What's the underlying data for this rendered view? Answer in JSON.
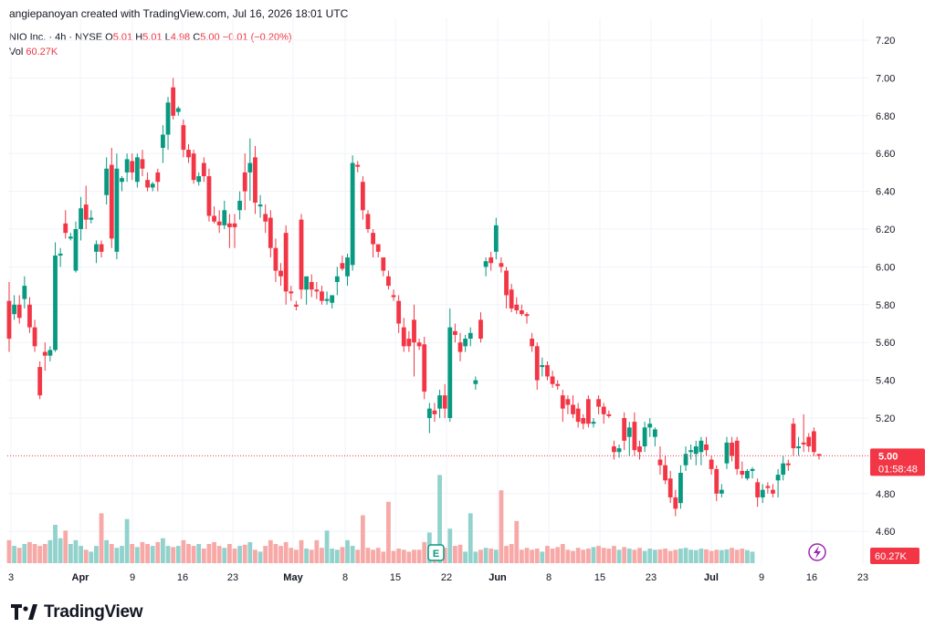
{
  "header": {
    "credit": "angiepanoyan created with TradingView.com, Jul 16, 2026 18:01 UTC"
  },
  "legend": {
    "symbol": "NIO Inc. · 4h · NYSE",
    "o_label": "O",
    "o_value": "5.01",
    "h_label": "H",
    "h_value": "5.01",
    "l_label": "L",
    "l_value": "4.98",
    "c_label": "C",
    "c_value": "5.00",
    "change": "−0.01 (−0.20%)",
    "vol_label": "Vol",
    "vol_value": "60.27K"
  },
  "brand": {
    "name": "TradingView"
  },
  "colors": {
    "up": "#089981",
    "down": "#f23645",
    "up_vol": "#92d2cc",
    "down_vol": "#f7a9a7",
    "grid": "#f0f3fa",
    "axis_text": "#131722"
  },
  "chart_data": {
    "type": "candlestick",
    "symbol": "NIO",
    "interval": "4h",
    "exchange": "NYSE",
    "ylim": [
      4.48,
      7.3
    ],
    "y_ticks": [
      "7.20",
      "7.00",
      "6.80",
      "6.60",
      "6.40",
      "6.20",
      "6.00",
      "5.80",
      "5.60",
      "5.40",
      "5.20",
      "4.80",
      "4.60"
    ],
    "x_ticks": [
      "3",
      "Apr",
      "9",
      "16",
      "23",
      "May",
      "8",
      "15",
      "22",
      "Jun",
      "8",
      "15",
      "23",
      "Jul",
      "9",
      "16",
      "23"
    ],
    "last_price": "5.00",
    "countdown": "01:58:48",
    "last_volume": "60.27K",
    "earnings_marker": "E",
    "candles": [
      [
        5.82,
        5.92,
        5.55,
        5.62
      ],
      [
        5.75,
        5.85,
        5.72,
        5.8
      ],
      [
        5.8,
        5.85,
        5.7,
        5.73
      ],
      [
        5.83,
        5.95,
        5.78,
        5.9
      ],
      [
        5.8,
        5.84,
        5.65,
        5.68
      ],
      [
        5.68,
        5.72,
        5.55,
        5.58
      ],
      [
        5.47,
        5.5,
        5.3,
        5.32
      ],
      [
        5.55,
        5.6,
        5.45,
        5.53
      ],
      [
        5.53,
        5.58,
        5.5,
        5.56
      ],
      [
        5.56,
        6.13,
        5.55,
        6.06
      ],
      [
        6.06,
        6.1,
        6.0,
        6.07
      ],
      [
        6.23,
        6.3,
        6.15,
        6.18
      ],
      [
        6.15,
        6.18,
        6.14,
        6.16
      ],
      [
        5.98,
        6.24,
        5.97,
        6.2
      ],
      [
        6.2,
        6.37,
        6.14,
        6.31
      ],
      [
        6.33,
        6.43,
        6.2,
        6.25
      ],
      [
        6.25,
        6.3,
        6.23,
        6.26
      ],
      [
        6.08,
        6.14,
        6.02,
        6.12
      ],
      [
        6.12,
        6.14,
        6.05,
        6.08
      ],
      [
        6.38,
        6.58,
        6.33,
        6.52
      ],
      [
        6.54,
        6.63,
        6.1,
        6.15
      ],
      [
        6.08,
        6.6,
        6.04,
        6.52
      ],
      [
        6.45,
        6.48,
        6.4,
        6.47
      ],
      [
        6.5,
        6.6,
        6.45,
        6.57
      ],
      [
        6.56,
        6.6,
        6.46,
        6.5
      ],
      [
        6.45,
        6.6,
        6.42,
        6.58
      ],
      [
        6.57,
        6.62,
        6.48,
        6.52
      ],
      [
        6.46,
        6.5,
        6.4,
        6.42
      ],
      [
        6.42,
        6.45,
        6.4,
        6.44
      ],
      [
        6.5,
        6.52,
        6.4,
        6.45
      ],
      [
        6.63,
        6.75,
        6.55,
        6.7
      ],
      [
        6.7,
        6.9,
        6.62,
        6.87
      ],
      [
        6.95,
        7.0,
        6.78,
        6.8
      ],
      [
        6.82,
        6.85,
        6.8,
        6.84
      ],
      [
        6.75,
        6.78,
        6.58,
        6.62
      ],
      [
        6.62,
        6.65,
        6.55,
        6.58
      ],
      [
        6.6,
        6.62,
        6.44,
        6.46
      ],
      [
        6.45,
        6.5,
        6.43,
        6.48
      ],
      [
        6.55,
        6.58,
        6.45,
        6.48
      ],
      [
        6.48,
        6.52,
        6.24,
        6.27
      ],
      [
        6.27,
        6.32,
        6.23,
        6.24
      ],
      [
        6.24,
        6.3,
        6.18,
        6.22
      ],
      [
        6.22,
        6.35,
        6.2,
        6.3
      ],
      [
        6.23,
        6.28,
        6.1,
        6.21
      ],
      [
        6.23,
        6.28,
        6.1,
        6.21
      ],
      [
        6.3,
        6.4,
        6.25,
        6.35
      ],
      [
        6.5,
        6.6,
        6.3,
        6.4
      ],
      [
        6.5,
        6.68,
        6.35,
        6.55
      ],
      [
        6.58,
        6.64,
        6.28,
        6.34
      ],
      [
        6.32,
        6.38,
        6.26,
        6.33
      ],
      [
        6.28,
        6.33,
        6.18,
        6.24
      ],
      [
        6.26,
        6.3,
        6.05,
        6.1
      ],
      [
        6.1,
        6.15,
        5.92,
        5.98
      ],
      [
        5.98,
        6.02,
        5.9,
        5.95
      ],
      [
        6.18,
        6.22,
        5.8,
        5.87
      ],
      [
        5.87,
        5.9,
        5.82,
        5.86
      ],
      [
        5.8,
        5.82,
        5.77,
        5.79
      ],
      [
        6.25,
        6.28,
        5.83,
        5.88
      ],
      [
        5.88,
        5.94,
        5.8,
        5.95
      ],
      [
        5.92,
        5.96,
        5.84,
        5.88
      ],
      [
        5.88,
        5.92,
        5.83,
        5.87
      ],
      [
        5.87,
        5.9,
        5.8,
        5.82
      ],
      [
        5.82,
        5.87,
        5.8,
        5.83
      ],
      [
        5.81,
        5.85,
        5.78,
        5.85
      ],
      [
        5.92,
        6.0,
        5.85,
        5.95
      ],
      [
        6.02,
        6.06,
        5.98,
        5.99
      ],
      [
        5.95,
        6.07,
        5.9,
        6.05
      ],
      [
        6.01,
        6.59,
        5.98,
        6.55
      ],
      [
        6.54,
        6.56,
        6.5,
        6.53
      ],
      [
        6.45,
        6.48,
        6.25,
        6.3
      ],
      [
        6.28,
        6.3,
        6.18,
        6.2
      ],
      [
        6.18,
        6.2,
        6.05,
        6.12
      ],
      [
        6.12,
        6.1,
        6.05,
        6.08
      ],
      [
        6.05,
        6.02,
        5.95,
        5.98
      ],
      [
        5.95,
        5.98,
        5.88,
        5.9
      ],
      [
        5.85,
        5.88,
        5.82,
        5.84
      ],
      [
        5.82,
        5.85,
        5.65,
        5.7
      ],
      [
        5.68,
        5.73,
        5.55,
        5.58
      ],
      [
        5.62,
        5.66,
        5.55,
        5.58
      ],
      [
        5.72,
        5.8,
        5.42,
        5.6
      ],
      [
        5.6,
        5.62,
        5.56,
        5.58
      ],
      [
        5.59,
        5.63,
        5.3,
        5.34
      ],
      [
        5.2,
        5.28,
        5.12,
        5.25
      ],
      [
        5.24,
        5.28,
        5.18,
        5.22
      ],
      [
        5.25,
        5.35,
        5.2,
        5.32
      ],
      [
        5.32,
        5.38,
        5.2,
        5.25
      ],
      [
        5.2,
        5.78,
        5.18,
        5.68
      ],
      [
        5.66,
        5.7,
        5.6,
        5.64
      ],
      [
        5.6,
        5.65,
        5.5,
        5.55
      ],
      [
        5.58,
        5.64,
        5.55,
        5.62
      ],
      [
        5.62,
        5.68,
        5.58,
        5.65
      ],
      [
        5.38,
        5.42,
        5.35,
        5.4
      ],
      [
        5.72,
        5.76,
        5.6,
        5.62
      ],
      [
        6.0,
        6.05,
        5.95,
        6.03
      ],
      [
        6.05,
        6.08,
        5.98,
        6.02
      ],
      [
        6.08,
        6.26,
        6.04,
        6.22
      ],
      [
        6.02,
        6.05,
        5.97,
        6.0
      ],
      [
        5.98,
        6.0,
        5.78,
        5.85
      ],
      [
        5.88,
        5.91,
        5.76,
        5.78
      ],
      [
        5.8,
        5.84,
        5.75,
        5.77
      ],
      [
        5.77,
        5.8,
        5.74,
        5.75
      ],
      [
        5.75,
        5.76,
        5.7,
        5.74
      ],
      [
        5.62,
        5.65,
        5.55,
        5.58
      ],
      [
        5.58,
        5.6,
        5.35,
        5.4
      ],
      [
        5.47,
        5.52,
        5.42,
        5.48
      ],
      [
        5.48,
        5.5,
        5.4,
        5.42
      ],
      [
        5.42,
        5.45,
        5.36,
        5.38
      ],
      [
        5.38,
        5.4,
        5.35,
        5.37
      ],
      [
        5.32,
        5.35,
        5.18,
        5.25
      ],
      [
        5.3,
        5.32,
        5.22,
        5.27
      ],
      [
        5.27,
        5.32,
        5.2,
        5.22
      ],
      [
        5.25,
        5.28,
        5.15,
        5.18
      ],
      [
        5.2,
        5.22,
        5.14,
        5.17
      ],
      [
        5.3,
        5.32,
        5.15,
        5.17
      ],
      [
        5.17,
        5.2,
        5.15,
        5.18
      ],
      [
        5.3,
        5.32,
        5.22,
        5.26
      ],
      [
        5.26,
        5.28,
        5.17,
        5.22
      ],
      [
        5.22,
        5.24,
        5.2,
        5.21
      ],
      [
        5.05,
        5.08,
        4.98,
        5.02
      ],
      [
        5.02,
        5.06,
        4.99,
        5.04
      ],
      [
        5.2,
        5.23,
        5.03,
        5.08
      ],
      [
        5.1,
        5.18,
        5.0,
        5.15
      ],
      [
        5.18,
        5.23,
        5.0,
        5.03
      ],
      [
        5.05,
        5.08,
        4.98,
        5.02
      ],
      [
        5.05,
        5.18,
        5.02,
        5.15
      ],
      [
        5.15,
        5.2,
        5.1,
        5.17
      ],
      [
        5.1,
        5.15,
        5.05,
        5.14
      ],
      [
        4.98,
        5.05,
        4.9,
        4.95
      ],
      [
        4.95,
        5.0,
        4.85,
        4.87
      ],
      [
        4.88,
        4.92,
        4.75,
        4.78
      ],
      [
        4.78,
        4.82,
        4.68,
        4.72
      ],
      [
        4.75,
        4.95,
        4.72,
        4.91
      ],
      [
        4.95,
        5.05,
        4.92,
        5.01
      ],
      [
        5.02,
        5.06,
        4.98,
        5.03
      ],
      [
        5.01,
        5.08,
        4.95,
        5.05
      ],
      [
        5.02,
        5.1,
        4.95,
        5.08
      ],
      [
        5.06,
        5.1,
        5.0,
        5.03
      ],
      [
        4.98,
        5.0,
        4.9,
        4.93
      ],
      [
        4.93,
        4.95,
        4.76,
        4.8
      ],
      [
        4.8,
        4.85,
        4.78,
        4.82
      ],
      [
        4.96,
        5.1,
        4.93,
        5.07
      ],
      [
        5.07,
        5.1,
        4.97,
        5.0
      ],
      [
        5.08,
        5.1,
        4.9,
        4.93
      ],
      [
        4.92,
        4.97,
        4.88,
        4.9
      ],
      [
        4.88,
        4.93,
        4.87,
        4.92
      ],
      [
        4.92,
        4.94,
        4.88,
        4.93
      ],
      [
        4.86,
        4.88,
        4.73,
        4.78
      ],
      [
        4.78,
        4.85,
        4.75,
        4.82
      ],
      [
        4.84,
        4.86,
        4.8,
        4.83
      ],
      [
        4.82,
        4.85,
        4.78,
        4.8
      ],
      [
        4.87,
        4.93,
        4.78,
        4.9
      ],
      [
        4.9,
        5.0,
        4.87,
        4.96
      ],
      [
        4.96,
        4.98,
        4.92,
        4.95
      ],
      [
        5.17,
        5.2,
        5.0,
        5.04
      ],
      [
        5.04,
        5.1,
        5.0,
        5.05
      ],
      [
        5.07,
        5.22,
        5.02,
        5.06
      ],
      [
        5.1,
        5.12,
        5.02,
        5.05
      ],
      [
        5.13,
        5.15,
        5.0,
        5.02
      ],
      [
        5.01,
        5.01,
        4.98,
        5.0
      ]
    ],
    "volumes": [
      0.6,
      0.45,
      0.4,
      0.5,
      0.55,
      0.5,
      0.45,
      0.5,
      0.6,
      1.0,
      0.65,
      0.85,
      0.5,
      0.6,
      0.45,
      0.35,
      0.3,
      0.45,
      0.4,
      0.6,
      0.5,
      0.4,
      0.45,
      0.85,
      0.5,
      0.42,
      0.55,
      0.5,
      0.45,
      0.55,
      0.65,
      0.45,
      0.42,
      0.45,
      0.6,
      0.5,
      0.45,
      0.5,
      0.38,
      0.5,
      0.55,
      0.45,
      0.4,
      0.5,
      0.38,
      0.45,
      0.48,
      0.55,
      0.35,
      0.3,
      0.45,
      0.6,
      0.5,
      0.45,
      0.55,
      0.4,
      0.35,
      0.6,
      0.38,
      0.35,
      0.6,
      0.4,
      0.42,
      0.38,
      0.35,
      0.42,
      0.6,
      0.45,
      0.35,
      0.38,
      0.4,
      0.35,
      0.4,
      0.3,
      0.35,
      0.32,
      0.38,
      0.35,
      0.3,
      0.35,
      0.35,
      0.55,
      0.8,
      0.3,
      0.3,
      0.4,
      0.9,
      0.45,
      0.48,
      0.3,
      0.35,
      0.3,
      0.35,
      0.4,
      0.38,
      0.35,
      0.4,
      0.45,
      0.5,
      0.4,
      0.35,
      0.4,
      0.35,
      0.38,
      0.3,
      0.45,
      0.38,
      0.42,
      0.5,
      0.35,
      0.32,
      0.4,
      0.35,
      0.38,
      0.42,
      0.45,
      0.4,
      0.38,
      0.45,
      0.35,
      0.42,
      0.38,
      0.35,
      0.4,
      0.32,
      0.38,
      0.35,
      0.36,
      0.38,
      0.32,
      0.35,
      0.38,
      0.4,
      0.35,
      0.34,
      0.38,
      0.36,
      0.32,
      0.35,
      0.34,
      0.36,
      0.4,
      0.35,
      0.38,
      0.34,
      0.3
    ],
    "volume_spikes": [
      [
        74,
        1.6
      ],
      [
        84,
        2.3
      ],
      [
        90,
        1.3
      ],
      [
        96,
        1.9
      ],
      [
        99,
        1.1
      ],
      [
        18,
        1.3
      ],
      [
        23,
        1.15
      ],
      [
        69,
        1.25
      ],
      [
        62,
        0.85
      ]
    ]
  }
}
